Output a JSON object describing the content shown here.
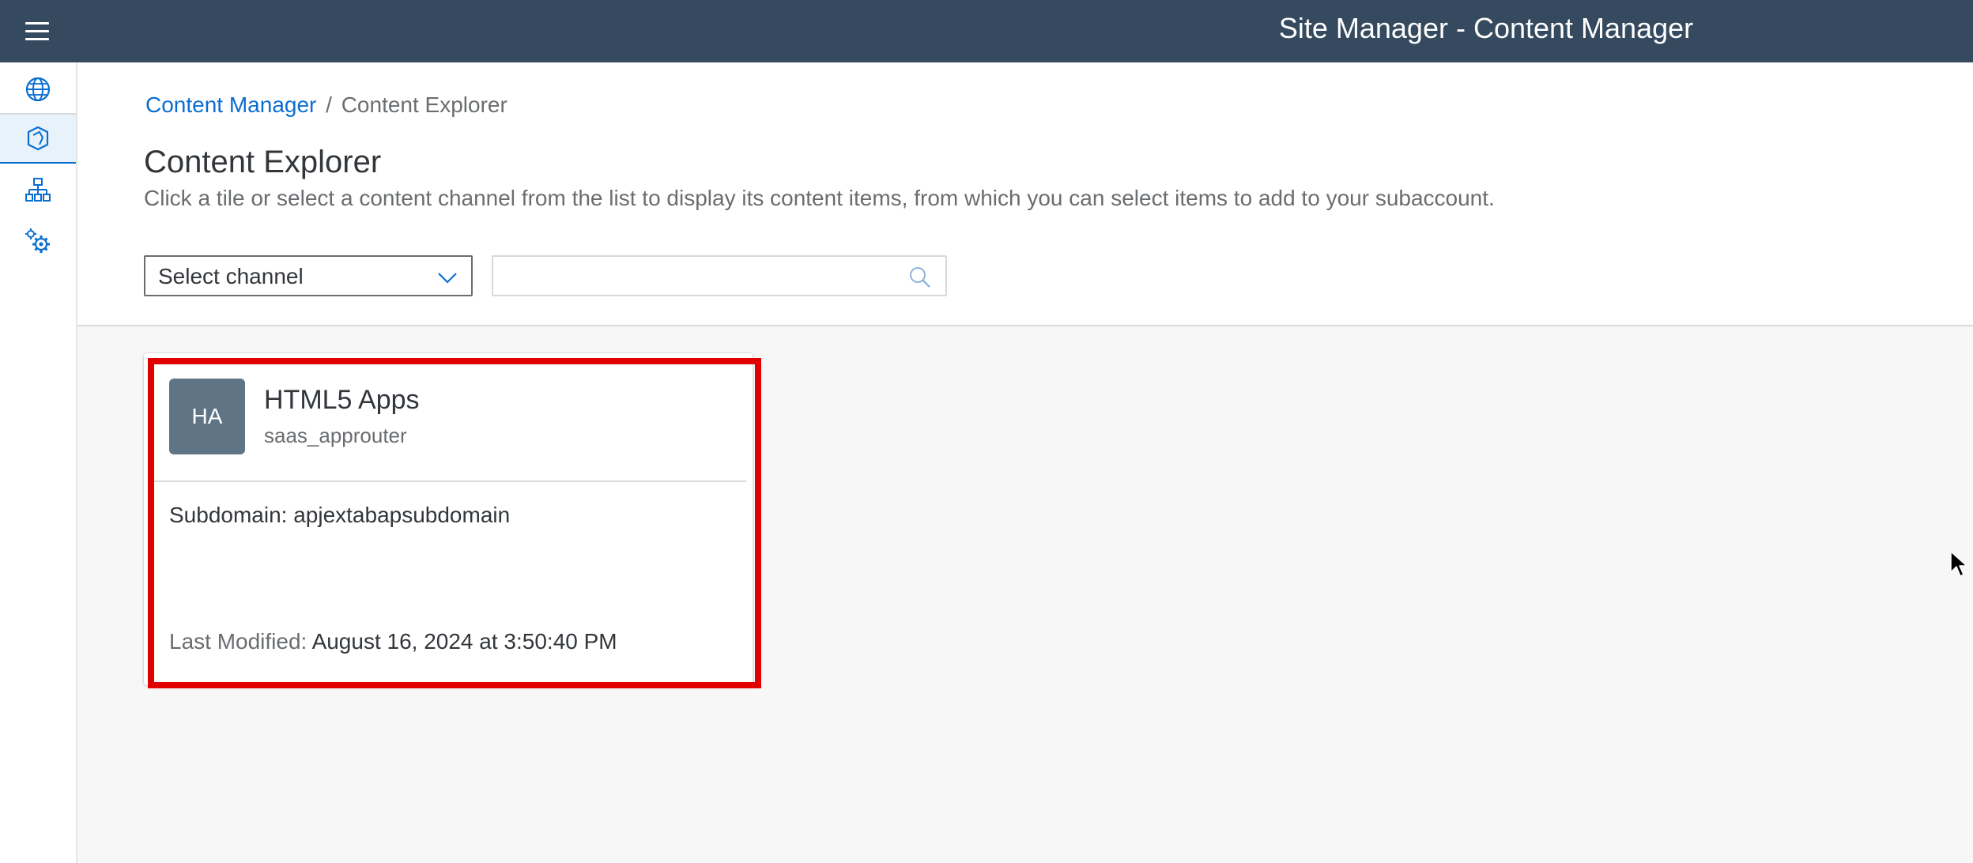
{
  "shell": {
    "title": "Site Manager - Content Manager",
    "menu_icon": "hamburger-menu-icon",
    "background": "#354a5f"
  },
  "sidenav": {
    "items": [
      {
        "icon": "globe-icon",
        "selected": false
      },
      {
        "icon": "content-box-icon",
        "selected": true
      },
      {
        "icon": "hierarchy-icon",
        "selected": false
      },
      {
        "icon": "settings-gears-icon",
        "selected": false
      }
    ]
  },
  "breadcrumb": {
    "link": "Content Manager",
    "separator": "/",
    "current": "Content Explorer"
  },
  "page": {
    "title": "Content Explorer",
    "subtitle": "Click a tile or select a content channel from the list to display its content items, from which you can select items to add to your subaccount."
  },
  "filters": {
    "channel_select": {
      "value": "Select channel",
      "icon": "chevron-down-icon"
    },
    "search": {
      "value": "",
      "placeholder": "",
      "icon": "search-icon"
    }
  },
  "tiles": [
    {
      "avatar_initials": "HA",
      "title": "HTML5 Apps",
      "subtitle": "saas_approuter",
      "subdomain": "Subdomain: apjextabapsubdomain",
      "modified_label": "Last Modified:",
      "modified_value": "August 16, 2024 at 3:50:40 PM",
      "highlighted": true
    }
  ],
  "colors": {
    "accent": "#0a6ed1",
    "highlight": "#e00000",
    "avatar": "#5f7585"
  }
}
